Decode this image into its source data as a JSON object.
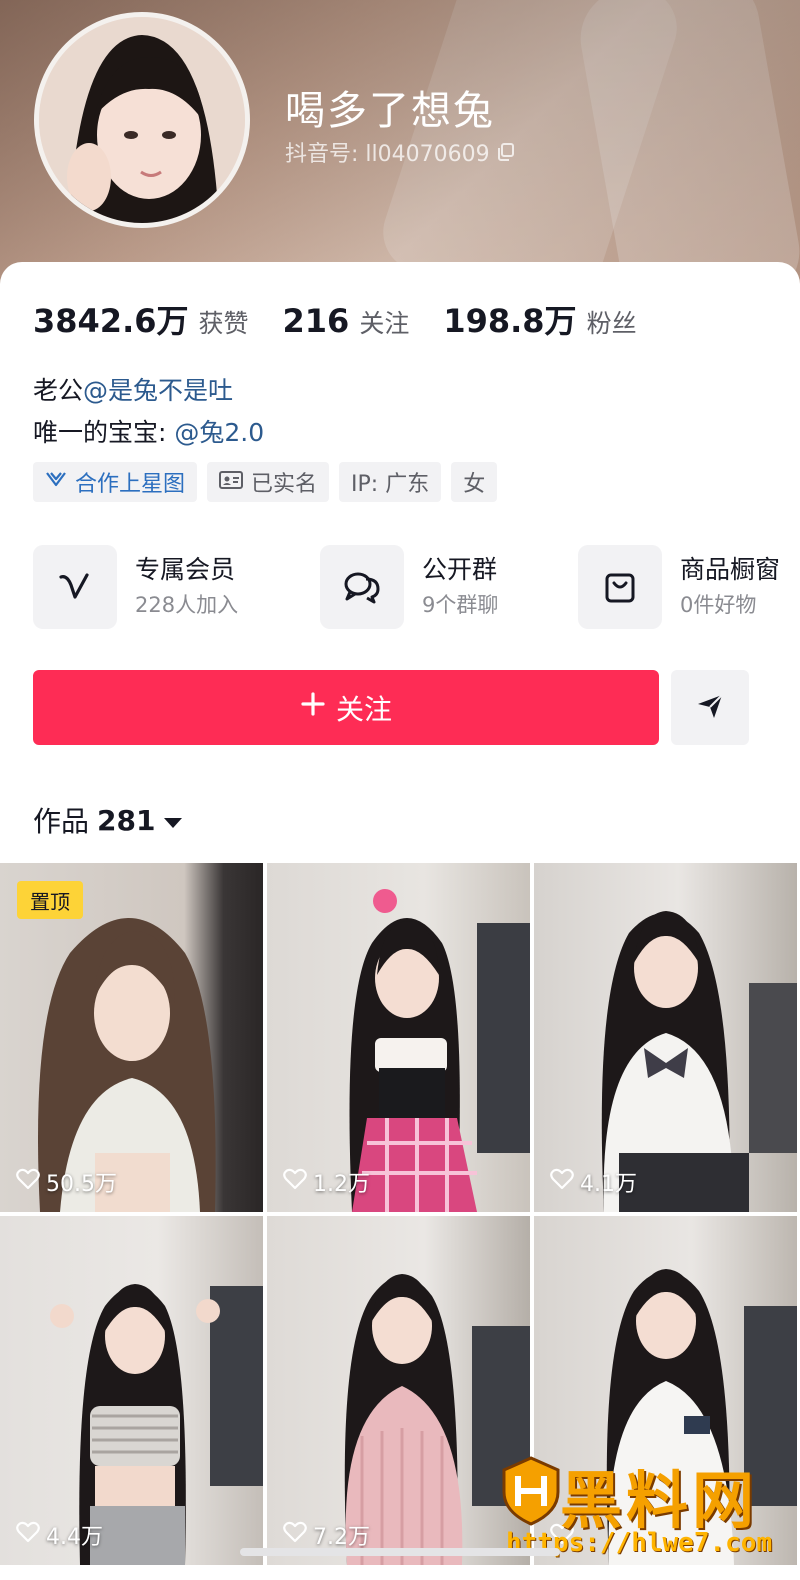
{
  "profile": {
    "nickname": "喝多了想兔",
    "douyin_id": "抖音号: ll04070609",
    "stats": [
      {
        "value": "3842.6万",
        "label": "获赞"
      },
      {
        "value": "216",
        "label": "关注"
      },
      {
        "value": "198.8万",
        "label": "粉丝"
      }
    ],
    "bio_line1_prefix": "老公",
    "bio_line1_mention": "@是兔不是吐",
    "bio_line2_prefix": "唯一的宝宝: ",
    "bio_line2_mention": "@兔2.0",
    "tags": [
      {
        "label": "合作上星图",
        "icon": "star-map-icon"
      },
      {
        "label": "已实名",
        "icon": "id-card-icon"
      },
      {
        "label": "IP: 广东",
        "icon": ""
      },
      {
        "label": "女",
        "icon": ""
      }
    ]
  },
  "features": [
    {
      "title": "专属会员",
      "subtitle": "228人加入",
      "icon": "v-membership-icon"
    },
    {
      "title": "公开群",
      "subtitle": "9个群聊",
      "icon": "group-chat-icon"
    },
    {
      "title": "商品橱窗",
      "subtitle": "0件好物",
      "icon": "shopping-bag-icon"
    }
  ],
  "actions": {
    "follow_label": "关注",
    "share_icon": "send-icon"
  },
  "works": {
    "title": "作品",
    "count": "281",
    "items": [
      {
        "pinned": true,
        "pin_label": "置顶",
        "likes": "50.5万"
      },
      {
        "pinned": false,
        "likes": "1.2万"
      },
      {
        "pinned": false,
        "likes": "4.1万"
      },
      {
        "pinned": false,
        "likes": "4.4万"
      },
      {
        "pinned": false,
        "likes": "7.2万"
      },
      {
        "pinned": false,
        "likes": ""
      }
    ]
  },
  "watermark": {
    "title": "黑料网",
    "url": "https://hlwe7.com"
  },
  "colors": {
    "accent": "#fe2c55",
    "mention": "#2c5a8e",
    "pin_badge": "#fdd337"
  }
}
